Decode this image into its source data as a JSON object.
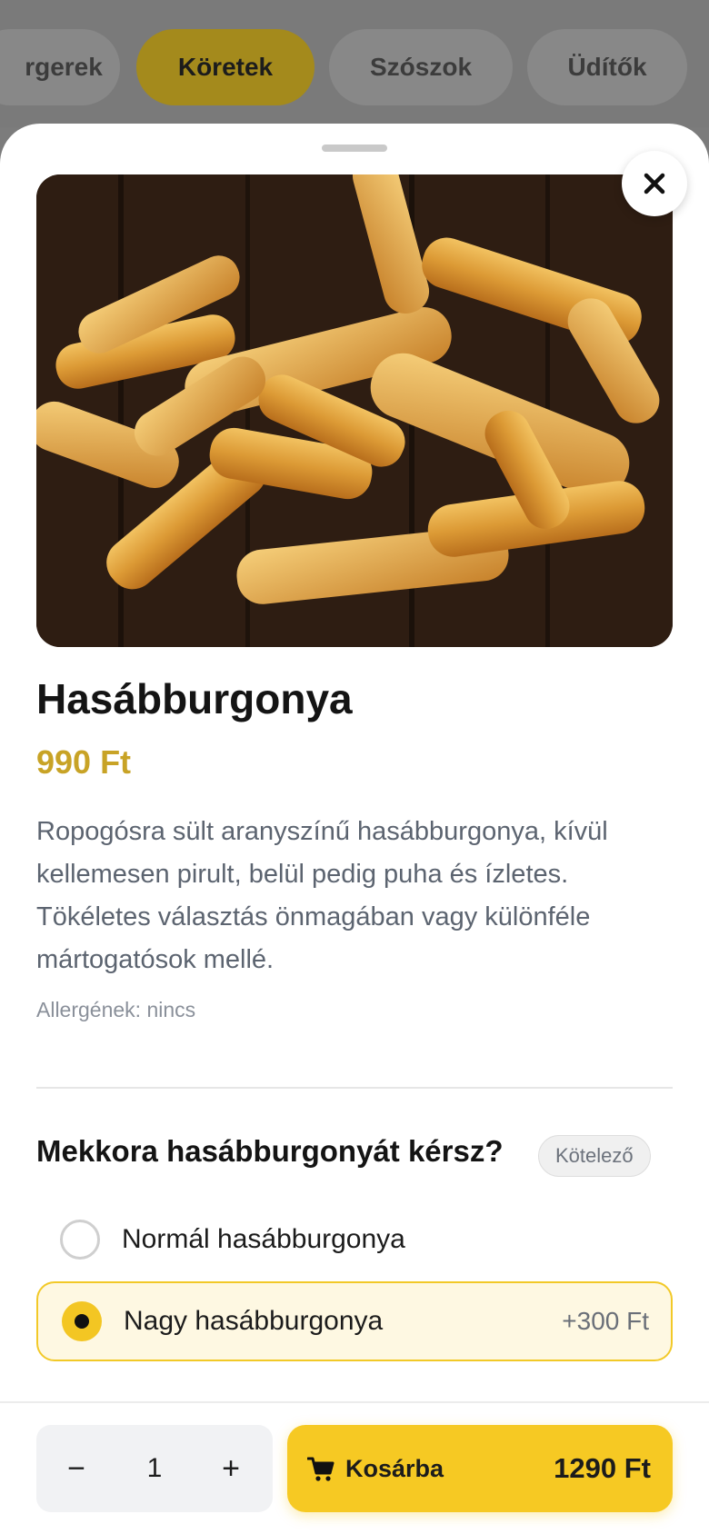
{
  "categories": {
    "items": [
      {
        "label": "rgerek",
        "active": false
      },
      {
        "label": "Köretek",
        "active": true
      },
      {
        "label": "Szószok",
        "active": false
      },
      {
        "label": "Üdítők",
        "active": false
      }
    ]
  },
  "product": {
    "name": "Hasábburgonya",
    "price": "990 Ft",
    "description": "Ropogósra sült aranyszínű hasábburgonya, kívül kellemesen pirult, belül pedig puha és ízletes. Tökéletes választás önmagában vagy különféle mártogatósok mellé.",
    "allergens": "Allergének: nincs"
  },
  "options": {
    "question": "Mekkora hasábburgonyát kérsz?",
    "badge": "Kötelező",
    "items": [
      {
        "label": "Normál hasábburgonya",
        "price": "",
        "selected": false
      },
      {
        "label": "Nagy hasábburgonya",
        "price": "+300 Ft",
        "selected": true
      }
    ]
  },
  "footer": {
    "minus": "−",
    "quantity": "1",
    "plus": "+",
    "add_label": "Kosárba",
    "total": "1290 Ft"
  },
  "icons": {
    "close": "close-icon",
    "cart": "cart-icon"
  },
  "colors": {
    "accent": "#f6c923",
    "price": "#c8a326"
  }
}
